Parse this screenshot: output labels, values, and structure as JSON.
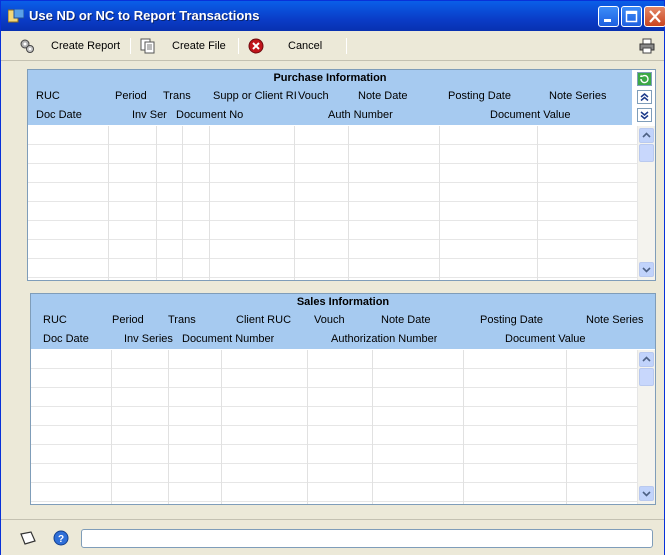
{
  "window": {
    "title": "Use ND or NC to Report Transactions"
  },
  "toolbar": {
    "create_report": "Create Report",
    "create_file": "Create File",
    "cancel": "Cancel"
  },
  "purchase": {
    "title": "Purchase Information",
    "hdr1": [
      "RUC",
      "Period",
      "Trans",
      "Supp or Client RI",
      "Vouch",
      "Note Date",
      "Posting Date",
      "Note Series"
    ],
    "hdr2": [
      "Doc Date",
      "Inv Ser",
      "Document No",
      "Auth Number",
      "Document Value"
    ]
  },
  "sales": {
    "title": "Sales Information",
    "hdr1": [
      "RUC",
      "Period",
      "Trans",
      "Client RUC",
      "Vouch",
      "Note Date",
      "Posting Date",
      "Note Series"
    ],
    "hdr2": [
      "Doc Date",
      "Inv Series",
      "Document Number",
      "Authorization Number",
      "Document Value"
    ]
  },
  "status": {
    "value": ""
  }
}
